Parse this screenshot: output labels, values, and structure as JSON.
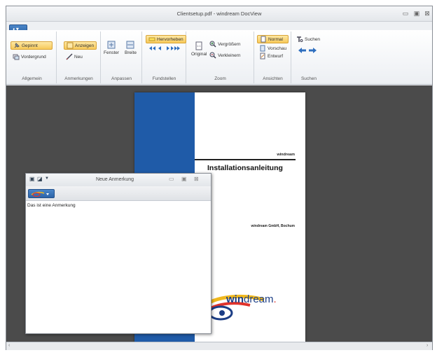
{
  "window": {
    "title": "Clientsetup.pdf - windream DocView"
  },
  "ribbon": {
    "groups": [
      {
        "label": "Allgemein",
        "buttons": [
          "Gepinnt",
          "Vordergrund"
        ]
      },
      {
        "label": "Anmerkungen",
        "buttons": [
          "Anzeigen",
          "Neu"
        ]
      },
      {
        "label": "Anpassen",
        "buttons": [
          "Fenster",
          "Breite"
        ]
      },
      {
        "label": "Fundstellen",
        "buttons": [
          "Hervorheben"
        ]
      },
      {
        "label": "Zoom",
        "buttons": [
          "Original",
          "Vergrößern",
          "Verkleinern"
        ]
      },
      {
        "label": "Ansichten",
        "buttons": [
          "Normal",
          "Vorschau",
          "Entwurf"
        ]
      },
      {
        "label": "Suchen",
        "buttons": [
          "Suchen"
        ]
      }
    ]
  },
  "document": {
    "brand_small": "windream",
    "title": "Installationsanleitung",
    "company": "windream GmbH, Bochum",
    "logo": {
      "part1": "win",
      "part2": "dream",
      "dot": "."
    }
  },
  "note_window": {
    "title": "Neue Anmerkung",
    "body": "Das ist eine Anmerkung"
  },
  "colors": {
    "accent_blue": "#1f5ba8",
    "active_button": "#f7c95a",
    "workspace": "#4b4b4b"
  }
}
